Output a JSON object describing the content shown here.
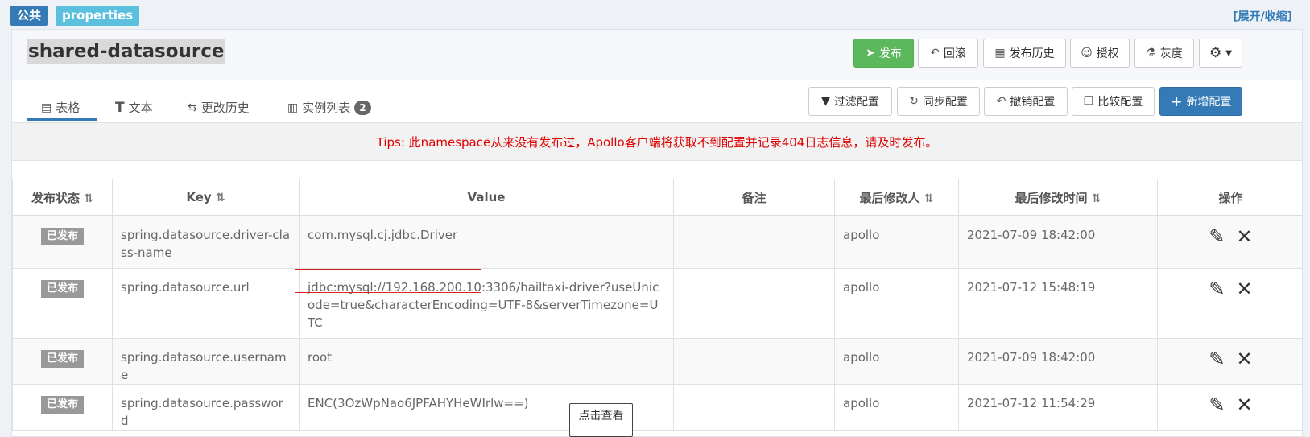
{
  "header": {
    "tag_public": "公共",
    "tag_type": "properties",
    "toggle_label": "[展开/收缩]"
  },
  "namespace": {
    "title": "shared-datasource"
  },
  "toolbar": {
    "publish": "发布",
    "rollback": "回滚",
    "publish_history": "发布历史",
    "authorize": "授权",
    "gray": "灰度"
  },
  "tabs": [
    {
      "label": "表格"
    },
    {
      "label": "文本"
    },
    {
      "label": "更改历史"
    },
    {
      "label": "实例列表",
      "count": "2"
    }
  ],
  "actions": {
    "filter": "过滤配置",
    "sync": "同步配置",
    "revoke": "撤销配置",
    "compare": "比较配置",
    "add": "新增配置"
  },
  "tips": "Tips: 此namespace从来没有发布过，Apollo客户端将获取不到配置并记录404日志信息，请及时发布。",
  "table": {
    "headers": {
      "status": "发布状态",
      "key": "Key",
      "value": "Value",
      "comment": "备注",
      "modifier": "最后修改人",
      "modified_time": "最后修改时间",
      "operation": "操作"
    },
    "rows": [
      {
        "status": "已发布",
        "key": "spring.datasource.driver-class-name",
        "value": "com.mysql.cj.jdbc.Driver",
        "comment": "",
        "modifier": "apollo",
        "time": "2021-07-09 18:42:00"
      },
      {
        "status": "已发布",
        "key": "spring.datasource.url",
        "value": "jdbc:mysql://192.168.200.10:3306/hailtaxi-driver?useUnicode=true&characterEncoding=UTF-8&serverTimezone=UTC",
        "comment": "",
        "modifier": "apollo",
        "time": "2021-07-12 15:48:19"
      },
      {
        "status": "已发布",
        "key": "spring.datasource.username",
        "value": "root",
        "comment": "",
        "modifier": "apollo",
        "time": "2021-07-09 18:42:00"
      },
      {
        "status": "已发布",
        "key": "spring.datasource.password",
        "value": "ENC(3OzWpNao6JPFAHYHeWIrlw==)",
        "comment": "",
        "modifier": "apollo",
        "time": "2021-07-12 11:54:29"
      }
    ]
  },
  "tooltip": "点击查看"
}
